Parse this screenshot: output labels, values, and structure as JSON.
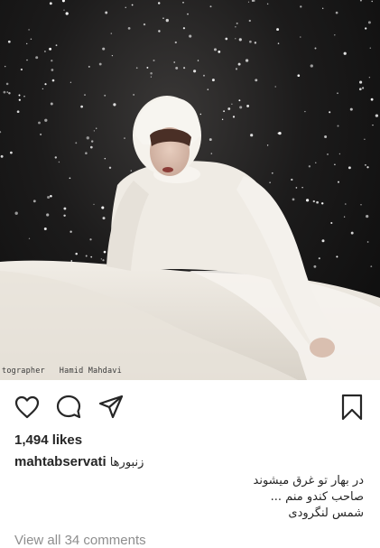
{
  "post": {
    "photo_alt": "woman in white dress on stage with falling snow",
    "photo_credit": "tographer   Hamid Mahdavi",
    "likes": "1,494 likes",
    "username": "mahtabservati",
    "caption_first": "زنبورها",
    "caption_lines": [
      "در بهار تو غرق میشوند",
      "صاحب کندو منم ...",
      "شمس لنگرودی"
    ],
    "view_comments": "View all 34 comments"
  },
  "icons": {
    "like": "heart-icon",
    "comment": "comment-icon",
    "share": "paper-plane-icon",
    "save": "bookmark-icon"
  },
  "colors": {
    "text": "#262626",
    "muted": "#8e8e8e",
    "photo_bg": "#141414"
  }
}
